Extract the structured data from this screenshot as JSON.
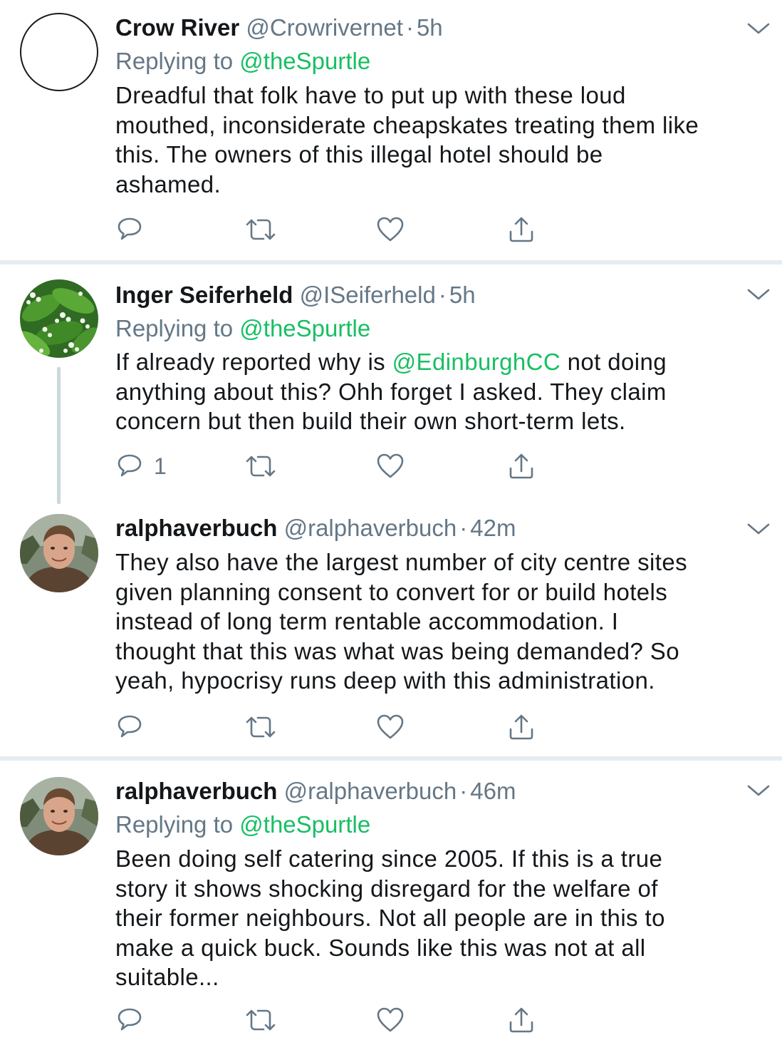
{
  "tweets": [
    {
      "name": "Crow River",
      "handle": "@Crowrivernet",
      "separator": "·",
      "time": "5h",
      "replying_label": "Replying to",
      "replying_to": "@theSpurtle",
      "lines": [
        "Dreadful that folk have to put up with these loud",
        "mouthed, inconsiderate cheapskates treating them like",
        "this. The owners of this illegal hotel should be",
        "ashamed."
      ],
      "reply_count": "",
      "avatar_icon": "empty-circle-avatar"
    },
    {
      "name": "Inger Seiferheld",
      "handle": "@ISeiferheld",
      "separator": "·",
      "time": "5h",
      "replying_label": "Replying to",
      "replying_to": "@theSpurtle",
      "line1_before": "If already reported why is ",
      "line1_mention": "@EdinburghCC",
      "line1_after": " not doing",
      "lines_rest": [
        "anything about this?  Ohh forget I asked. They claim",
        "concern but then build their own short-term lets."
      ],
      "reply_count": "1",
      "avatar_icon": "lily-of-the-valley-photo"
    },
    {
      "name": "ralphaverbuch",
      "handle": "@ralphaverbuch",
      "separator": "·",
      "time": "42m",
      "lines": [
        "They also have the largest number of city centre sites",
        "given planning consent to convert for or build hotels",
        "instead of long term rentable accommodation. I",
        "thought that this was what was being demanded? So",
        "yeah, hypocrisy runs deep with this administration."
      ],
      "reply_count": "",
      "avatar_icon": "man-portrait-photo"
    },
    {
      "name": "ralphaverbuch",
      "handle": "@ralphaverbuch",
      "separator": "·",
      "time": "46m",
      "replying_label": "Replying to",
      "replying_to": "@theSpurtle",
      "lines": [
        "Been doing self catering since 2005. If this is a true",
        "story it shows shocking disregard for the welfare of",
        "their former neighbours. Not all people are in this to",
        "make a quick buck. Sounds like this was not at all",
        "suitable..."
      ],
      "reply_count": "",
      "avatar_icon": "man-portrait-photo"
    }
  ],
  "icons": {
    "reply": "reply-icon",
    "retweet": "retweet-icon",
    "like": "heart-icon",
    "share": "share-icon",
    "menu": "chevron-down-icon"
  },
  "colors": {
    "mention": "#17bf63",
    "secondary_text": "#657786",
    "divider": "#e6ecf0",
    "thread_line": "#ccd6dd"
  }
}
